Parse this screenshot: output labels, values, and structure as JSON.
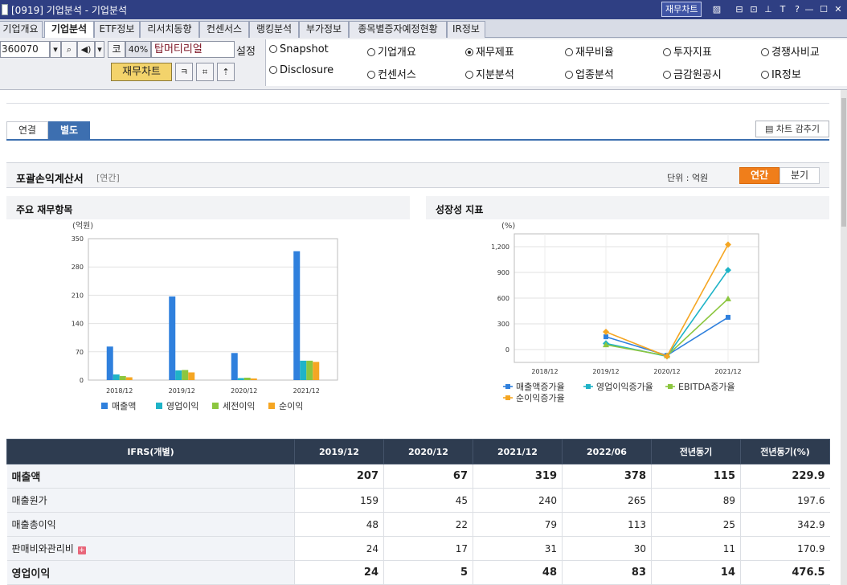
{
  "window": {
    "title": "[0919] 기업분석 - 기업분석",
    "chart_button": "재무차트"
  },
  "tabs": [
    "기업개요",
    "기업분석",
    "ETF정보",
    "리서치동향",
    "컨센서스",
    "랭킹분석",
    "부가정보",
    "종목별증자예정현황",
    "IR정보"
  ],
  "controls": {
    "stock_code": "360070",
    "market_tag": "코",
    "ratio": "40%",
    "company_name": "탑머티리얼",
    "setting_label": "설정",
    "fin_chart_button": "재무차트"
  },
  "radio_options": [
    {
      "label": "Snapshot",
      "checked": false
    },
    {
      "label": "기업개요",
      "checked": false
    },
    {
      "label": "재무제표",
      "checked": true
    },
    {
      "label": "재무비율",
      "checked": false
    },
    {
      "label": "투자지표",
      "checked": false
    },
    {
      "label": "경쟁사비교",
      "checked": false
    },
    {
      "label": "Disclosure",
      "checked": false
    },
    {
      "label": "컨센서스",
      "checked": false
    },
    {
      "label": "지분분석",
      "checked": false
    },
    {
      "label": "업종분석",
      "checked": false
    },
    {
      "label": "금감원공시",
      "checked": false
    },
    {
      "label": "IR정보",
      "checked": false
    }
  ],
  "sub_tabs": [
    "연결",
    "별도"
  ],
  "chart_hide_button": "차트 감추기",
  "section": {
    "title": "포괄손익계산서",
    "sub": "[연간]",
    "unit": "단위 : 억원",
    "periods": [
      "연간",
      "분기"
    ]
  },
  "chart_data": [
    {
      "type": "bar",
      "title": "주요 재무항목",
      "ylabel": "(억원)",
      "categories": [
        "2018/12",
        "2019/12",
        "2020/12",
        "2021/12"
      ],
      "ylim": [
        0,
        350
      ],
      "yticks": [
        0,
        70,
        140,
        210,
        280,
        350
      ],
      "series": [
        {
          "name": "매출액",
          "color": "#2f80dd",
          "values": [
            83,
            207,
            67,
            319
          ]
        },
        {
          "name": "영업이익",
          "color": "#1fb3c7",
          "values": [
            14,
            24,
            5,
            48
          ]
        },
        {
          "name": "세전이익",
          "color": "#8cc63f",
          "values": [
            10,
            25,
            6,
            48
          ]
        },
        {
          "name": "순이익",
          "color": "#f5a623",
          "values": [
            7,
            19,
            4,
            45
          ]
        }
      ],
      "grid": true,
      "legend": "bottom"
    },
    {
      "type": "line",
      "title": "성장성 지표",
      "ylabel": "(%)",
      "categories": [
        "2018/12",
        "2019/12",
        "2020/12",
        "2021/12"
      ],
      "ylim": [
        -150,
        1350
      ],
      "yticks": [
        0,
        300,
        600,
        900,
        1200
      ],
      "ytick_labels": [
        "0",
        "300",
        "600",
        "900",
        "1,200"
      ],
      "series": [
        {
          "name": "매출액증가율",
          "color": "#2f80dd",
          "marker": "square",
          "values": [
            null,
            149,
            -68,
            376
          ]
        },
        {
          "name": "영업이익증가율",
          "color": "#1fb3c7",
          "marker": "diamond",
          "values": [
            null,
            71,
            -79,
            927
          ]
        },
        {
          "name": "EBITDA증가율",
          "color": "#8cc63f",
          "marker": "triangle",
          "values": [
            null,
            55,
            -72,
            592
          ]
        },
        {
          "name": "순이익증가율",
          "color": "#f5a623",
          "marker": "diamond",
          "values": [
            null,
            206,
            -78,
            1225
          ]
        }
      ],
      "grid": true,
      "legend": "bottom"
    }
  ],
  "table": {
    "headers": [
      "IFRS(개별)",
      "2019/12",
      "2020/12",
      "2021/12",
      "2022/06",
      "전년동기",
      "전년동기(%)"
    ],
    "rows": [
      {
        "label": "매출액",
        "bold": true,
        "expandable": false,
        "values": [
          "207",
          "67",
          "319",
          "378",
          "115",
          "229.9"
        ]
      },
      {
        "label": "매출원가",
        "bold": false,
        "expandable": false,
        "values": [
          "159",
          "45",
          "240",
          "265",
          "89",
          "197.6"
        ]
      },
      {
        "label": "매출총이익",
        "bold": false,
        "expandable": false,
        "values": [
          "48",
          "22",
          "79",
          "113",
          "25",
          "342.9"
        ]
      },
      {
        "label": "판매비와관리비",
        "bold": false,
        "expandable": true,
        "values": [
          "24",
          "17",
          "31",
          "30",
          "11",
          "170.9"
        ]
      },
      {
        "label": "영업이익",
        "bold": true,
        "expandable": false,
        "values": [
          "24",
          "5",
          "48",
          "83",
          "14",
          "476.5"
        ]
      }
    ]
  }
}
